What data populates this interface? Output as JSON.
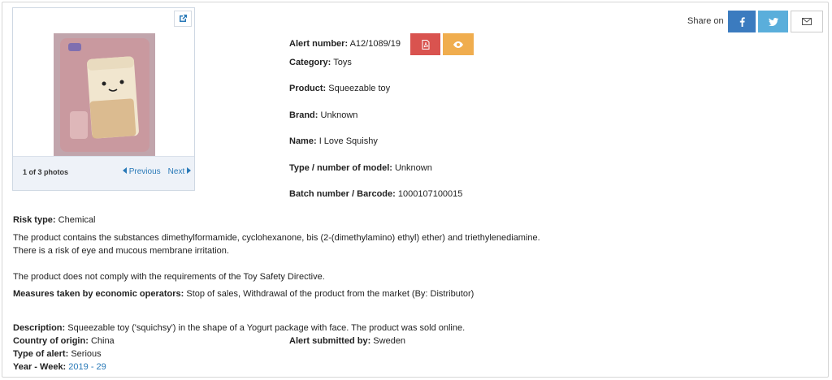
{
  "photo": {
    "count_text": "1 of 3 photos",
    "previous_label": "Previous",
    "next_label": "Next"
  },
  "share": {
    "label": "Share on"
  },
  "alert": {
    "number_label": "Alert number:",
    "number": "A12/1089/19",
    "category_label": "Category:",
    "category": "Toys",
    "product_label": "Product:",
    "product": "Squeezable toy",
    "brand_label": "Brand:",
    "brand": "Unknown",
    "name_label": "Name:",
    "name": "I Love Squishy",
    "model_label": "Type / number of model:",
    "model": "Unknown",
    "batch_label": "Batch number / Barcode:",
    "batch": "1000107100015"
  },
  "risk": {
    "type_label": "Risk type:",
    "type": "Chemical",
    "text1": "The product contains the substances dimethylformamide, cyclohexanone, bis (2-(dimethylamino) ethyl) ether) and triethylenediamine.",
    "text2": "There is a risk of eye and mucous membrane irritation.",
    "text3": "The product does not comply with the requirements of the Toy Safety Directive."
  },
  "measures": {
    "label": "Measures taken by economic operators:",
    "value": "Stop of sales, Withdrawal of the product from the market (By: Distributor)"
  },
  "details": {
    "description_label": "Description:",
    "description": "Squeezable toy ('squichsy') in the shape of a Yogurt package with face. The product was sold online.",
    "origin_label": "Country of origin:",
    "origin": "China",
    "submitted_label": "Alert submitted by:",
    "submitted": "Sweden",
    "alert_type_label": "Type of alert:",
    "alert_type": "Serious",
    "year_week_label": "Year - Week:",
    "year_week": "2019 - 29"
  },
  "colors": {
    "facebook": "#3b7bbf",
    "twitter": "#5aaedb",
    "pdf": "#d9534f",
    "view": "#f0ad4e",
    "link": "#2a7ab8"
  },
  "icons": [
    "expand-icon",
    "facebook-icon",
    "twitter-icon",
    "envelope-icon",
    "pdf-icon",
    "eye-icon",
    "caret-left-icon",
    "caret-right-icon"
  ]
}
